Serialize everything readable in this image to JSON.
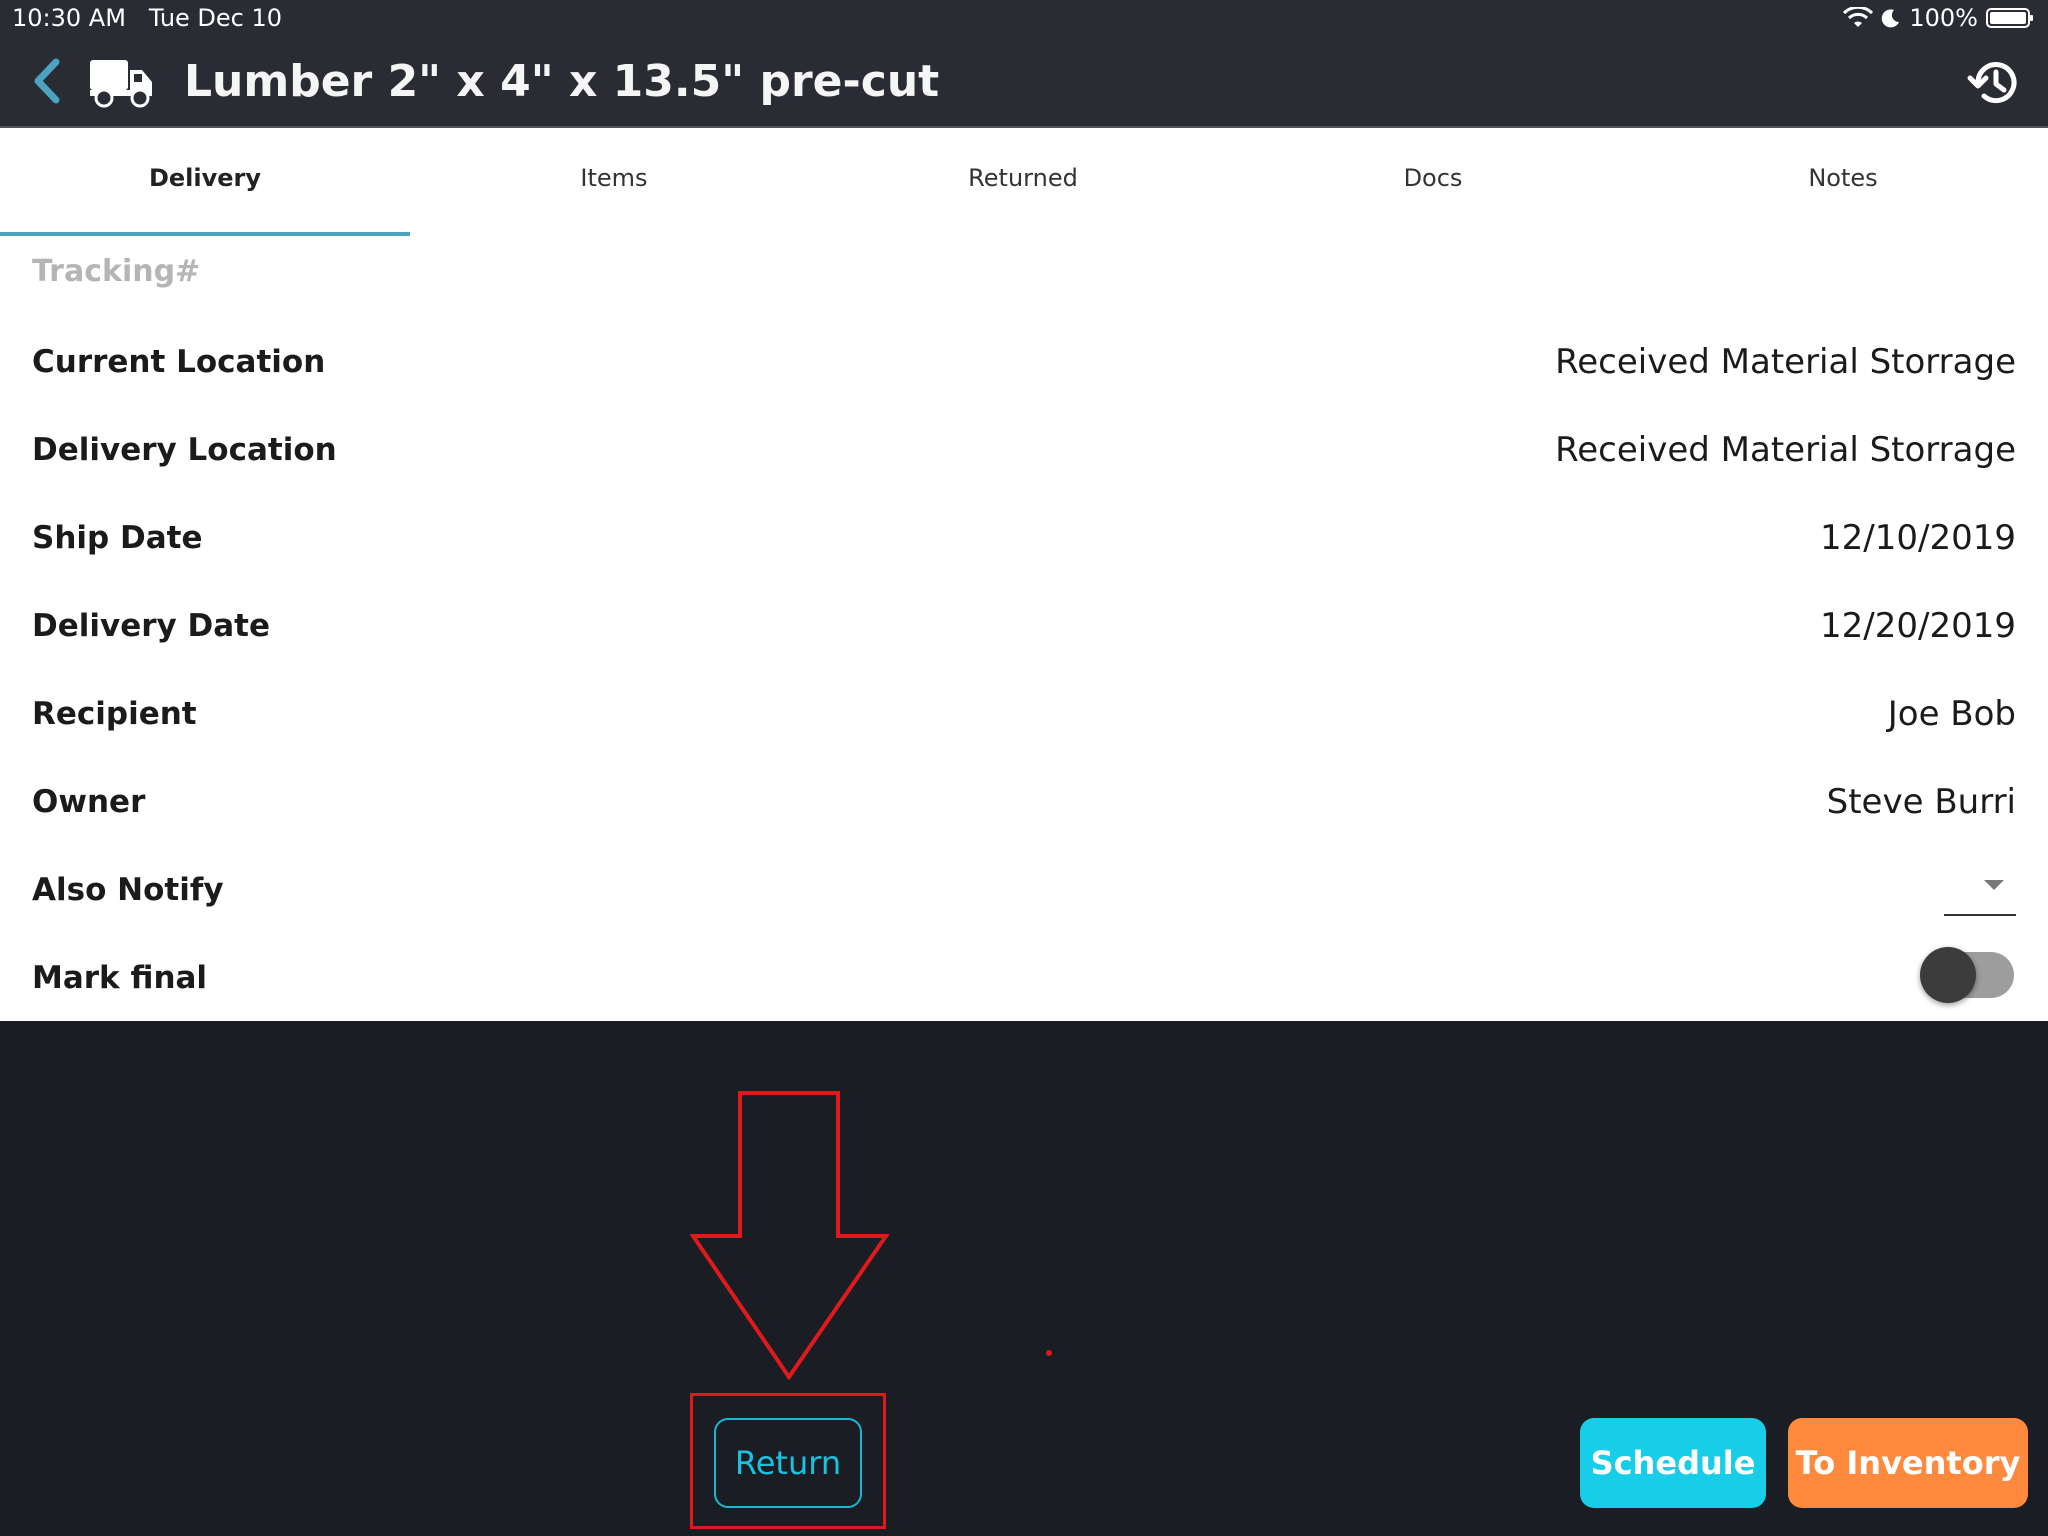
{
  "status_bar": {
    "time": "10:30 AM",
    "date": "Tue Dec 10",
    "battery": "100%",
    "icons": [
      "wifi-icon",
      "moon-icon",
      "battery-icon"
    ]
  },
  "nav": {
    "title": "Lumber 2\" x 4\" x 13.5\" pre-cut",
    "icons": [
      "chevron-left-icon",
      "truck-icon",
      "history-icon"
    ]
  },
  "tabs": [
    {
      "label": "Delivery",
      "active": true
    },
    {
      "label": "Items",
      "active": false
    },
    {
      "label": "Returned",
      "active": false
    },
    {
      "label": "Docs",
      "active": false
    },
    {
      "label": "Notes",
      "active": false
    }
  ],
  "form": {
    "tracking_placeholder": "Tracking#",
    "rows": [
      {
        "label": "Current Location",
        "value": "Received Material Storrage"
      },
      {
        "label": "Delivery Location",
        "value": "Received Material Storrage"
      },
      {
        "label": "Ship Date",
        "value": "12/10/2019"
      },
      {
        "label": "Delivery Date",
        "value": "12/20/2019"
      },
      {
        "label": "Recipient",
        "value": "Joe Bob"
      },
      {
        "label": "Owner",
        "value": "Steve Burri"
      }
    ],
    "also_notify": {
      "label": "Also Notify",
      "value": ""
    },
    "mark_final": {
      "label": "Mark final",
      "on": false
    }
  },
  "actions": {
    "return": "Return",
    "schedule": "Schedule",
    "to_inventory": "To Inventory"
  },
  "colors": {
    "accent": "#19c2e0",
    "schedule": "#18cde8",
    "to_inventory": "#ff8a3d",
    "annotation": "#e0191d",
    "tab_indicator": "#4aa3bf",
    "header": "#2a2c34",
    "footer": "#1b1d25"
  }
}
